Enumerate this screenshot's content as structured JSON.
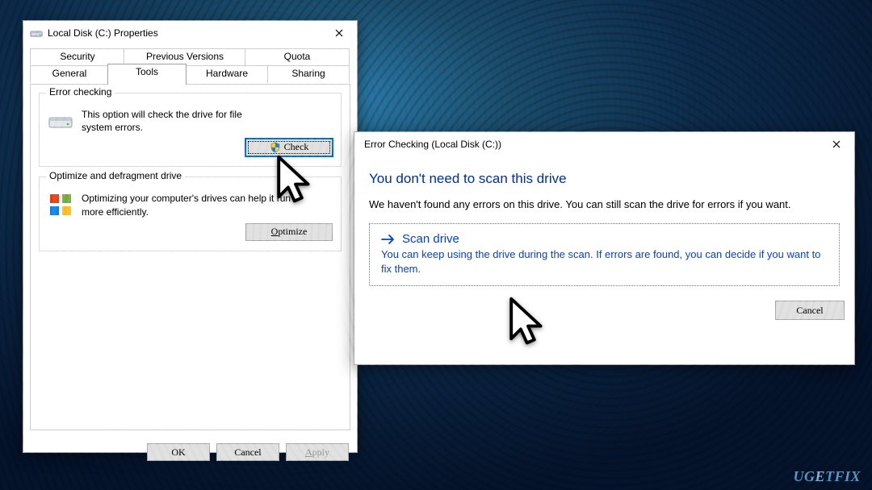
{
  "properties": {
    "title": "Local Disk (C:) Properties",
    "tabs_row1": [
      "Security",
      "Previous Versions",
      "Quota"
    ],
    "tabs_row2": [
      "General",
      "Tools",
      "Hardware",
      "Sharing"
    ],
    "active_tab": "Tools",
    "error_checking": {
      "group_title": "Error checking",
      "text": "This option will check the drive for file system errors.",
      "button": "Check"
    },
    "optimize": {
      "group_title": "Optimize and defragment drive",
      "text": "Optimizing your computer's drives can help it run more efficiently.",
      "button": "Optimize"
    },
    "buttons": {
      "ok": "OK",
      "cancel": "Cancel",
      "apply": "Apply"
    }
  },
  "errchk": {
    "title": "Error Checking (Local Disk (C:))",
    "headline": "You don't need to scan this drive",
    "subtext": "We haven't found any errors on this drive. You can still scan the drive for errors if you want.",
    "option_title": "Scan drive",
    "option_desc": "You can keep using the drive during the scan. If errors are found, you can decide if you want to fix them.",
    "cancel": "Cancel"
  },
  "watermark": "UGETFIX"
}
